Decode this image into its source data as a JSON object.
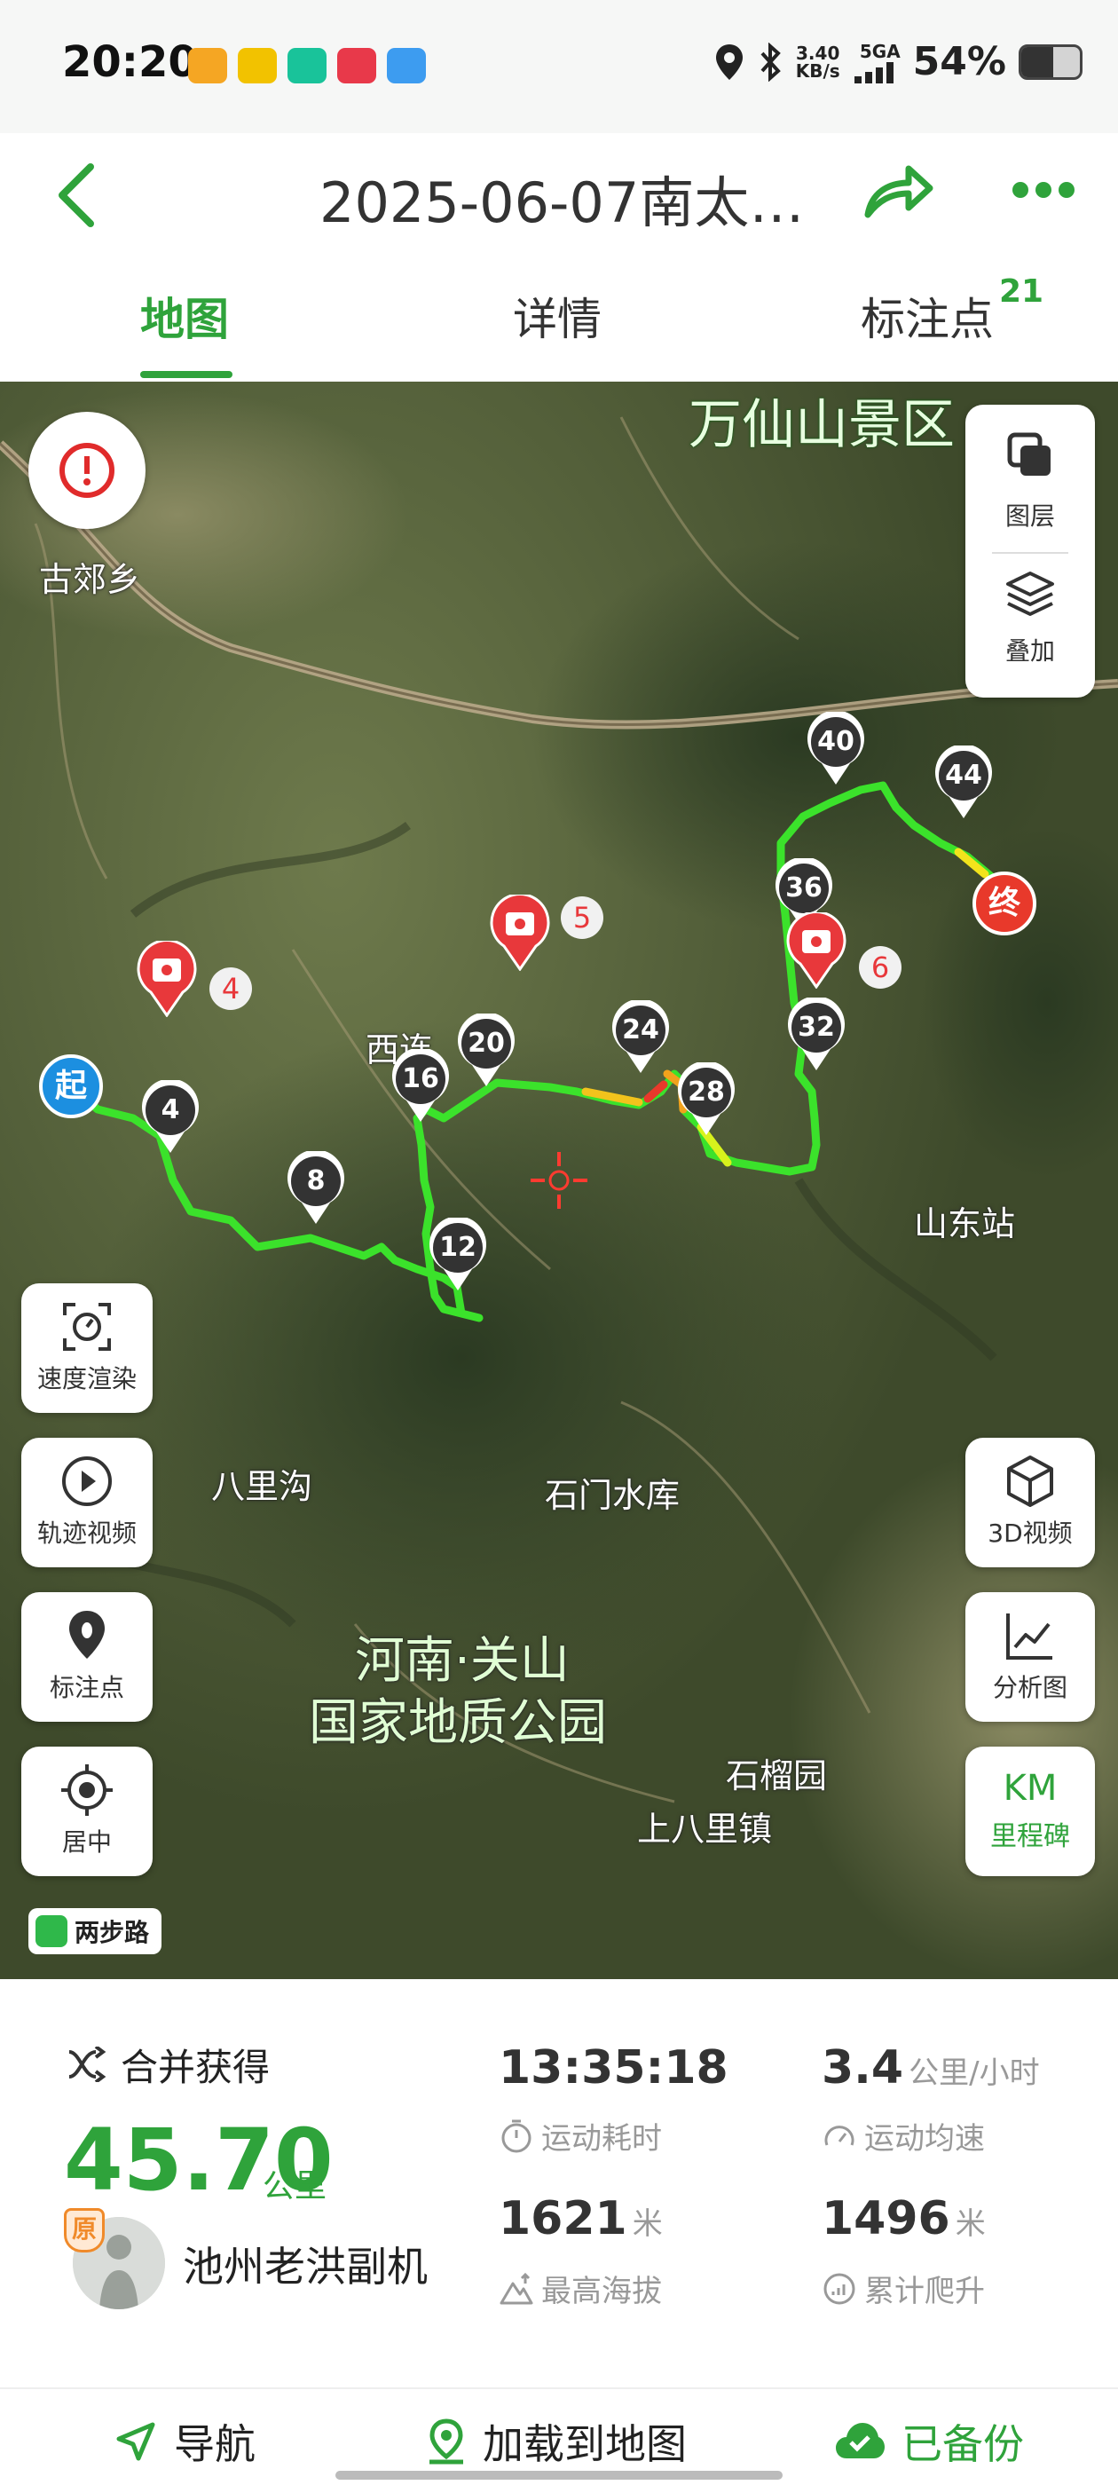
{
  "status_bar": {
    "time": "20:20",
    "net_speed_value": "3.40",
    "net_speed_unit": "KB/s",
    "network_type": "5GA",
    "battery_percent": "54%",
    "battery_level": 0.54,
    "app_icon_colors": [
      "#f5a623",
      "#f2c200",
      "#19c39a",
      "#e8394a",
      "#3d9cf0"
    ]
  },
  "header": {
    "title": "2025-06-07南太…",
    "back_icon": "chevron-left-icon",
    "share_icon": "share-arrow-icon",
    "more_icon": "more-dots-icon"
  },
  "tabs": [
    {
      "label": "地图",
      "active": true
    },
    {
      "label": "详情",
      "active": false
    },
    {
      "label": "标注点",
      "active": false,
      "badge": "21"
    }
  ],
  "map": {
    "place_labels": [
      "万仙山景区",
      "古郊乡",
      "西连",
      "山东站",
      "八里沟",
      "石门水库",
      "河南·关山",
      "国家地质公园",
      "石榴园",
      "上八里镇"
    ],
    "start_label": "起",
    "end_label": "终",
    "km_markers": [
      "4",
      "8",
      "12",
      "16",
      "20",
      "24",
      "28",
      "32",
      "36",
      "40",
      "44"
    ],
    "photo_markers": [
      "4",
      "5",
      "6"
    ],
    "layer_button": "图层",
    "overlay_button": "叠加",
    "left_buttons": [
      "速度渲染",
      "轨迹视频",
      "标注点",
      "居中"
    ],
    "right_buttons": [
      "3D视频",
      "分析图"
    ],
    "milestone_button": {
      "top": "KM",
      "bottom": "里程碑"
    },
    "watermark": "两步路",
    "track_color": "#3be22b",
    "accent": "#2fa33b"
  },
  "stats": {
    "merged_label": "合并获得",
    "distance": "45.70",
    "distance_unit": "公里",
    "user_badge": "原",
    "user_name": "池州老洪副机",
    "duration": "13:35:18",
    "duration_label": "运动耗时",
    "avg_speed": "3.4",
    "avg_speed_unit": "公里/小时",
    "avg_speed_label": "运动均速",
    "max_altitude": "1621",
    "max_altitude_unit": "米",
    "max_altitude_label": "最高海拔",
    "total_climb": "1496",
    "total_climb_unit": "米",
    "total_climb_label": "累计爬升"
  },
  "bottom_bar": {
    "navigate": "导航",
    "load_to_map": "加载到地图",
    "backed_up": "已备份"
  }
}
